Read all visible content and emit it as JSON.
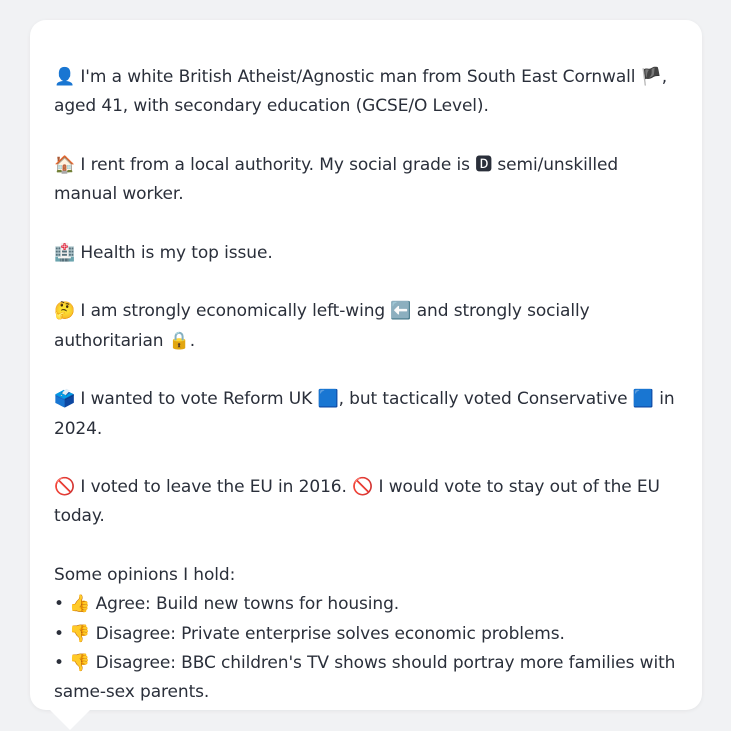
{
  "profile": {
    "identity": {
      "icon": "person-silhouette-icon",
      "text": "👤 I'm a white British Atheist/Agnostic man from South East Cornwall 🏴, aged 41, with secondary education (GCSE/O Level)."
    },
    "housing": {
      "icon": "house-icon",
      "text": "🏠 I rent from a local authority. My social grade is 🅳 semi/unskilled manual worker."
    },
    "top_issue": {
      "icon": "hospital-icon",
      "text": "🏥 Health is my top issue."
    },
    "ideology": {
      "icon": "thinking-face-icon",
      "text": "🤔 I am strongly economically left-wing ⬅️ and strongly socially authoritarian 🔒."
    },
    "vote": {
      "icon": "ballot-box-icon",
      "text": "🗳️ I wanted to vote Reform UK 🟦, but tactically voted Conservative 🟦 in 2024."
    },
    "eu": {
      "icon": "no-entry-icon",
      "text": "🚫 I voted to leave the EU in 2016. 🚫 I would vote to stay out of the EU today."
    },
    "opinions": {
      "heading": "Some opinions I hold:",
      "items": [
        {
          "icon": "thumbs-up-icon",
          "text": "• 👍 Agree: Build new towns for housing."
        },
        {
          "icon": "thumbs-down-icon",
          "text": "• 👎 Disagree: Private enterprise solves economic problems."
        },
        {
          "icon": "thumbs-down-icon",
          "text": "• 👎 Disagree: BBC children's TV shows should portray more families with same-sex parents."
        }
      ]
    }
  }
}
